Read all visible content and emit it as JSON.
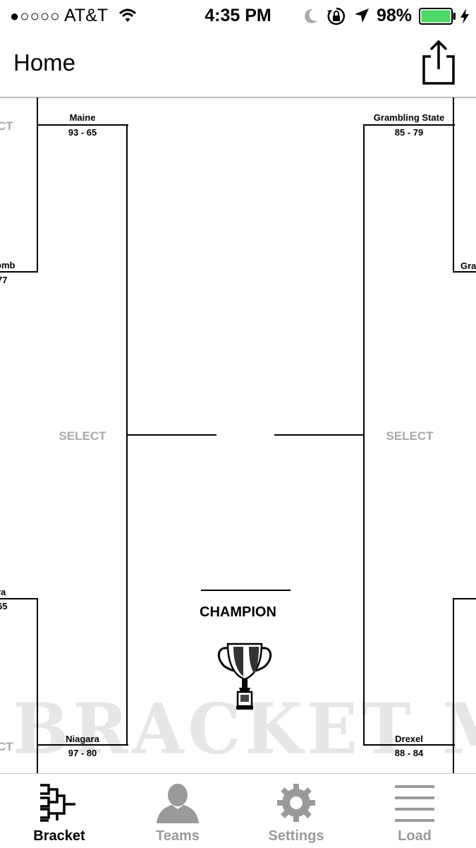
{
  "status_bar": {
    "signal_dots": "●○○○○",
    "carrier": "AT&T",
    "time": "4:35 PM",
    "battery_percent": "98%",
    "battery_color": "#4cd964",
    "icons": [
      "wifi-icon",
      "moon-icon",
      "rotation-lock-icon",
      "location-arrow-icon",
      "battery-icon",
      "charging-bolt-icon"
    ]
  },
  "nav": {
    "title": "Home",
    "share_icon": "share-icon"
  },
  "bracket": {
    "left_top_partial": {
      "select": "CT",
      "team": "omb",
      "score": "77"
    },
    "left_top_winner": {
      "team": "Maine",
      "score": "93 - 65"
    },
    "left_semi": {
      "select": "SELECT"
    },
    "left_bottom_partial": {
      "team": "ra",
      "score": "65",
      "select": "CT"
    },
    "left_bottom_winner": {
      "team": "Niagara",
      "score": "97 - 80"
    },
    "right_top_winner": {
      "team": "Grambling State",
      "score": "85 - 79"
    },
    "right_top_partial": {
      "team": "Gra"
    },
    "right_semi": {
      "select": "SELECT"
    },
    "right_bottom_winner": {
      "team": "Drexel",
      "score": "88 - 84"
    },
    "champion_label": "CHAMPION",
    "watermark": "BRACKET MAKER"
  },
  "tabs": [
    {
      "label": "Bracket",
      "icon": "bracket-icon",
      "active": true
    },
    {
      "label": "Teams",
      "icon": "person-icon",
      "active": false
    },
    {
      "label": "Settings",
      "icon": "gear-icon",
      "active": false
    },
    {
      "label": "Load",
      "icon": "list-icon",
      "active": false
    }
  ],
  "colors": {
    "select_gray": "#a9a9a9",
    "inactive_tab": "#9a9a9a",
    "watermark_gray": "#e6e6e6"
  }
}
